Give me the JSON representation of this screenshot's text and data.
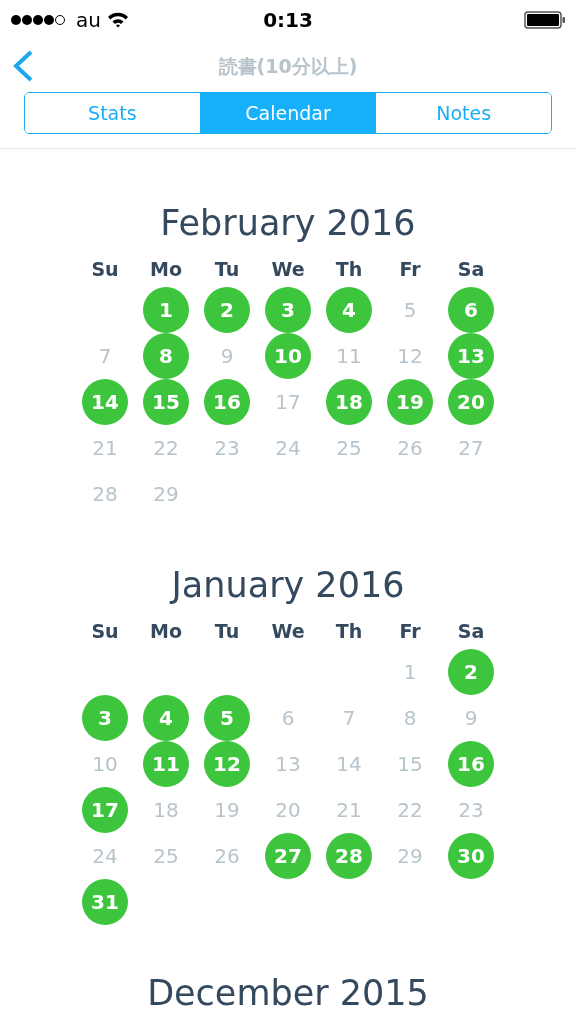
{
  "status_bar": {
    "carrier": "au",
    "time": "0:13"
  },
  "nav": {
    "title": "読書(10分以上)"
  },
  "tabs": [
    {
      "label": "Stats",
      "selected": false
    },
    {
      "label": "Calendar",
      "selected": true
    },
    {
      "label": "Notes",
      "selected": false
    }
  ],
  "months": [
    {
      "title": "February 2016",
      "weekdays": [
        "Su",
        "Mo",
        "Tu",
        "We",
        "Th",
        "Fr",
        "Sa"
      ],
      "weeks": [
        {
          "kind": "start",
          "days": [
            {
              "day": "1",
              "done": true
            },
            {
              "day": "2",
              "done": true
            },
            {
              "day": "3",
              "done": true
            },
            {
              "day": "4",
              "done": true
            },
            {
              "day": "5",
              "done": false
            },
            {
              "day": "6",
              "done": true
            }
          ]
        },
        {
          "kind": "full",
          "days": [
            {
              "day": "7",
              "done": false
            },
            {
              "day": "8",
              "done": true
            },
            {
              "day": "9",
              "done": false
            },
            {
              "day": "10",
              "done": true
            },
            {
              "day": "11",
              "done": false
            },
            {
              "day": "12",
              "done": false
            },
            {
              "day": "13",
              "done": true
            }
          ]
        },
        {
          "kind": "full",
          "days": [
            {
              "day": "14",
              "done": true
            },
            {
              "day": "15",
              "done": true
            },
            {
              "day": "16",
              "done": true
            },
            {
              "day": "17",
              "done": false
            },
            {
              "day": "18",
              "done": true
            },
            {
              "day": "19",
              "done": true
            },
            {
              "day": "20",
              "done": true
            }
          ]
        },
        {
          "kind": "full",
          "days": [
            {
              "day": "21",
              "done": false
            },
            {
              "day": "22",
              "done": false
            },
            {
              "day": "23",
              "done": false
            },
            {
              "day": "24",
              "done": false
            },
            {
              "day": "25",
              "done": false
            },
            {
              "day": "26",
              "done": false
            },
            {
              "day": "27",
              "done": false
            }
          ]
        },
        {
          "kind": "end",
          "days": [
            {
              "day": "28",
              "done": false
            },
            {
              "day": "29",
              "done": false
            }
          ]
        }
      ]
    },
    {
      "title": "January 2016",
      "weekdays": [
        "Su",
        "Mo",
        "Tu",
        "We",
        "Th",
        "Fr",
        "Sa"
      ],
      "weeks": [
        {
          "kind": "start",
          "days": [
            {
              "day": "1",
              "done": false
            },
            {
              "day": "2",
              "done": true
            }
          ]
        },
        {
          "kind": "full",
          "days": [
            {
              "day": "3",
              "done": true
            },
            {
              "day": "4",
              "done": true
            },
            {
              "day": "5",
              "done": true
            },
            {
              "day": "6",
              "done": false
            },
            {
              "day": "7",
              "done": false
            },
            {
              "day": "8",
              "done": false
            },
            {
              "day": "9",
              "done": false
            }
          ]
        },
        {
          "kind": "full",
          "days": [
            {
              "day": "10",
              "done": false
            },
            {
              "day": "11",
              "done": true
            },
            {
              "day": "12",
              "done": true
            },
            {
              "day": "13",
              "done": false
            },
            {
              "day": "14",
              "done": false
            },
            {
              "day": "15",
              "done": false
            },
            {
              "day": "16",
              "done": true
            }
          ]
        },
        {
          "kind": "full",
          "days": [
            {
              "day": "17",
              "done": true
            },
            {
              "day": "18",
              "done": false
            },
            {
              "day": "19",
              "done": false
            },
            {
              "day": "20",
              "done": false
            },
            {
              "day": "21",
              "done": false
            },
            {
              "day": "22",
              "done": false
            },
            {
              "day": "23",
              "done": false
            }
          ]
        },
        {
          "kind": "full",
          "days": [
            {
              "day": "24",
              "done": false
            },
            {
              "day": "25",
              "done": false
            },
            {
              "day": "26",
              "done": false
            },
            {
              "day": "27",
              "done": true
            },
            {
              "day": "28",
              "done": true
            },
            {
              "day": "29",
              "done": false
            },
            {
              "day": "30",
              "done": true
            }
          ]
        },
        {
          "kind": "end",
          "days": [
            {
              "day": "31",
              "done": true
            }
          ]
        }
      ]
    },
    {
      "title": "December 2015"
    }
  ]
}
